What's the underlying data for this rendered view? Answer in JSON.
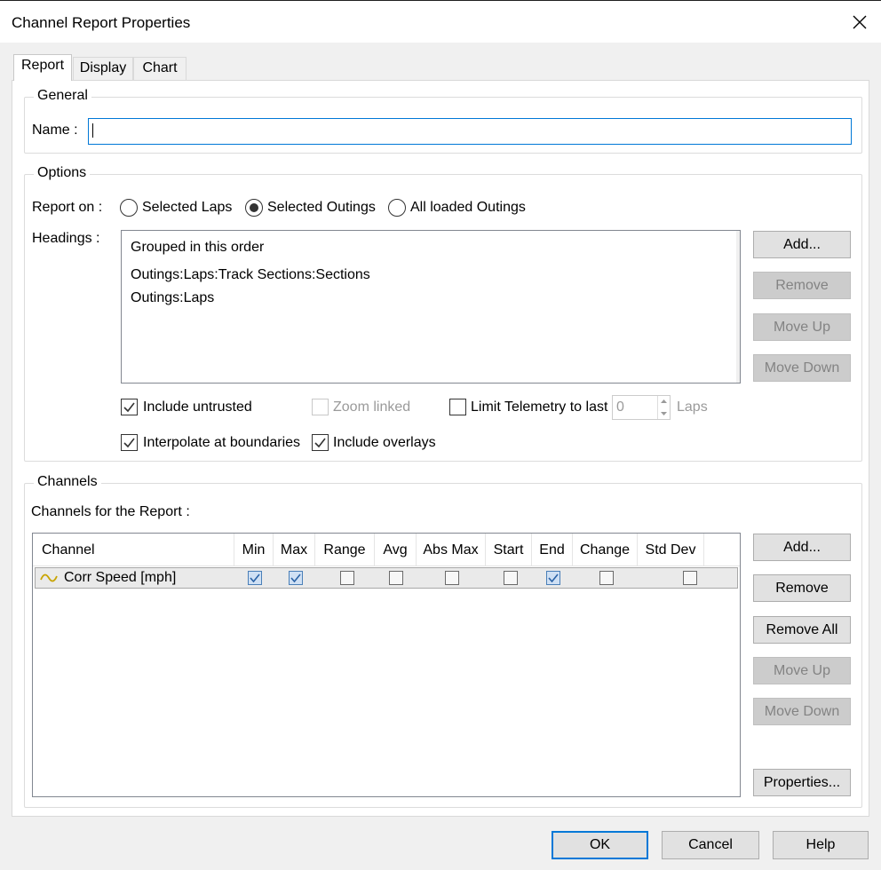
{
  "window": {
    "title": "Channel Report Properties",
    "close_icon": "close-icon"
  },
  "tabs": [
    {
      "label": "Report",
      "active": true
    },
    {
      "label": "Display",
      "active": false
    },
    {
      "label": "Chart",
      "active": false
    }
  ],
  "general": {
    "legend": "General",
    "name_label": "Name :",
    "name_value": ""
  },
  "options": {
    "legend": "Options",
    "report_on_label": "Report on :",
    "report_on": [
      {
        "label": "Selected Laps",
        "checked": false
      },
      {
        "label": "Selected Outings",
        "checked": true
      },
      {
        "label": "All loaded Outings",
        "checked": false
      }
    ],
    "headings_label": "Headings :",
    "headings_box": {
      "title": "Grouped in this order",
      "items": [
        "Outings:Laps:Track Sections:Sections",
        "Outings:Laps"
      ]
    },
    "heading_buttons": [
      {
        "label": "Add...",
        "enabled": true
      },
      {
        "label": "Remove",
        "enabled": false
      },
      {
        "label": "Move Up",
        "enabled": false
      },
      {
        "label": "Move Down",
        "enabled": false
      }
    ],
    "include_untrusted": {
      "label": "Include untrusted",
      "checked": true
    },
    "zoom_linked": {
      "label": "Zoom linked",
      "checked": false,
      "enabled": false
    },
    "limit_telemetry": {
      "label": "Limit Telemetry to last",
      "checked": false
    },
    "laps_value": "0",
    "laps_unit": "Laps",
    "interpolate": {
      "label": "Interpolate at boundaries",
      "checked": true
    },
    "include_overlays": {
      "label": "Include overlays",
      "checked": true
    }
  },
  "channels": {
    "legend": "Channels",
    "for_report_label": "Channels for the Report :",
    "columns": [
      "Channel",
      "Min",
      "Max",
      "Range",
      "Avg",
      "Abs Max",
      "Start",
      "End",
      "Change",
      "Std Dev"
    ],
    "rows": [
      {
        "icon": "waveform-icon",
        "icon_color": "#c8a400",
        "name": "Corr Speed [mph]",
        "checks": [
          true,
          true,
          false,
          false,
          false,
          false,
          true,
          false,
          false
        ]
      }
    ],
    "buttons": [
      {
        "label": "Add...",
        "enabled": true
      },
      {
        "label": "Remove",
        "enabled": true
      },
      {
        "label": "Remove All",
        "enabled": true
      },
      {
        "label": "Move Up",
        "enabled": false
      },
      {
        "label": "Move Down",
        "enabled": false
      },
      {
        "label": "Properties...",
        "enabled": true
      }
    ]
  },
  "footer": {
    "ok": "OK",
    "cancel": "Cancel",
    "help": "Help"
  },
  "colors": {
    "accent": "#0078d7",
    "disabled_button": "#cccccc",
    "dialog_bg": "#f0f0f0"
  }
}
